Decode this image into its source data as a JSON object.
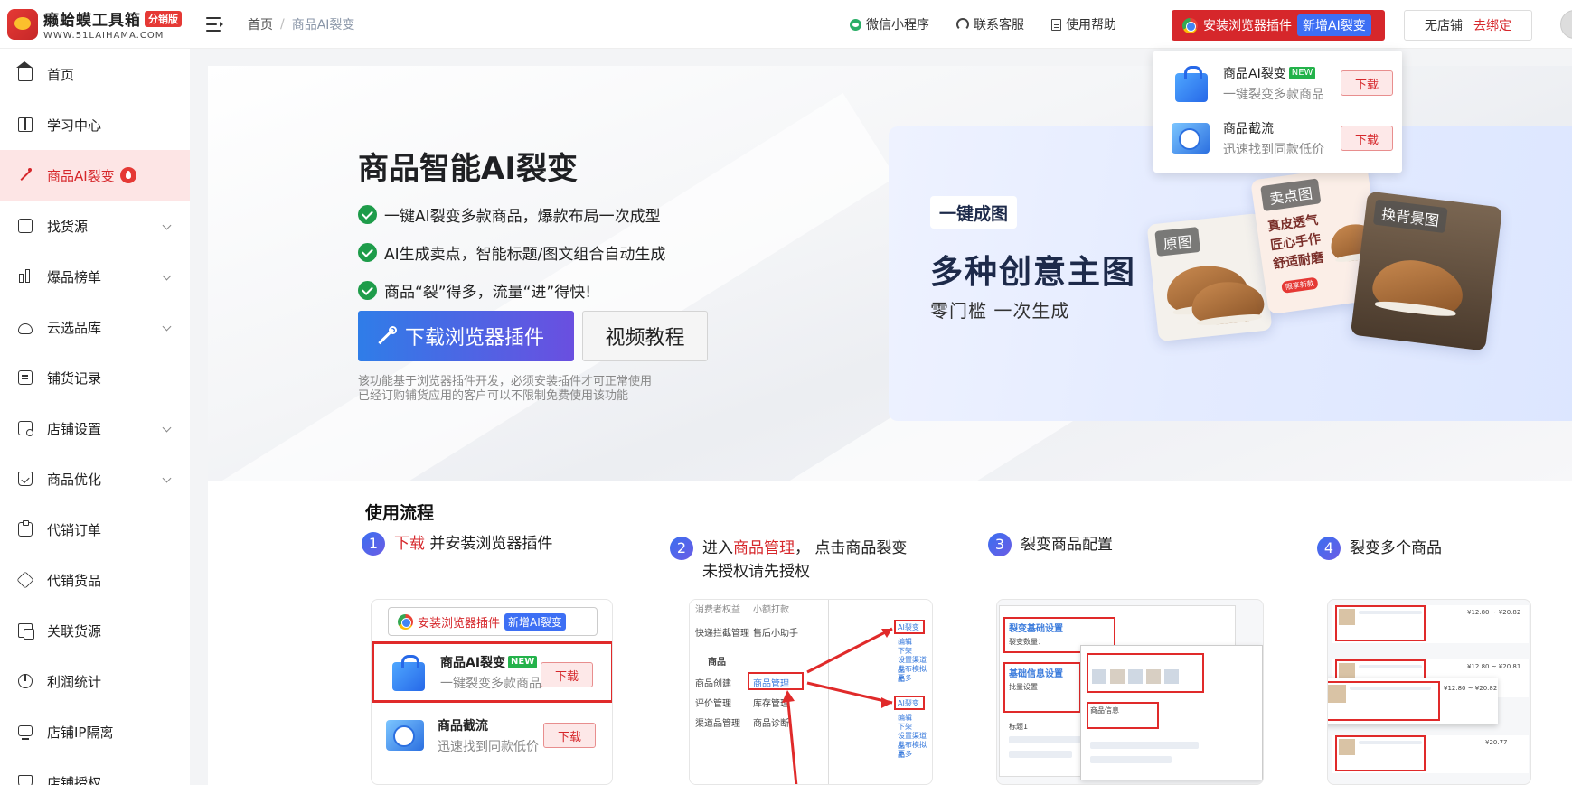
{
  "header": {
    "logo_title": "癞蛤蟆工具箱",
    "logo_badge": "分销版",
    "logo_sub": "WWW.51LAIHAMA.COM",
    "breadcrumb": [
      "首页",
      "/",
      "商品AI裂变"
    ],
    "links": [
      {
        "icon": "wechat-icon",
        "label": "微信小程序"
      },
      {
        "icon": "headset-icon",
        "label": "联系客服"
      },
      {
        "icon": "document-icon",
        "label": "使用帮助"
      }
    ],
    "install_button": {
      "label": "安装浏览器插件",
      "tag": "新增AI裂变"
    },
    "store": {
      "label": "无店铺",
      "action": "去绑定"
    }
  },
  "sidebar": {
    "items": [
      {
        "label": "首页",
        "icon": "home-icon",
        "chevron": false
      },
      {
        "label": "学习中心",
        "icon": "book-icon",
        "chevron": false
      },
      {
        "label": "商品AI裂变",
        "icon": "magic-wand-icon",
        "chevron": false,
        "active": true,
        "badge": "fire-icon"
      },
      {
        "label": "找货源",
        "icon": "inbox-icon",
        "chevron": true
      },
      {
        "label": "爆品榜单",
        "icon": "bar-chart-icon",
        "chevron": true
      },
      {
        "label": "云选品库",
        "icon": "cloud-icon",
        "chevron": true
      },
      {
        "label": "铺货记录",
        "icon": "list-icon",
        "chevron": false
      },
      {
        "label": "店铺设置",
        "icon": "shop-settings-icon",
        "chevron": true
      },
      {
        "label": "商品优化",
        "icon": "bag-check-icon",
        "chevron": true
      },
      {
        "label": "代销订单",
        "icon": "clipboard-icon",
        "chevron": false
      },
      {
        "label": "代销货品",
        "icon": "box-icon",
        "chevron": false
      },
      {
        "label": "关联货源",
        "icon": "link-icon",
        "chevron": false
      },
      {
        "label": "利润统计",
        "icon": "pie-chart-icon",
        "chevron": false
      },
      {
        "label": "店铺IP隔离",
        "icon": "monitor-icon",
        "chevron": false
      },
      {
        "label": "店铺授权",
        "icon": "shield-icon",
        "chevron": false
      }
    ]
  },
  "popover": {
    "items": [
      {
        "title": "商品AI裂变",
        "tag": "NEW",
        "desc": "一键裂变多款商品",
        "button": "下载"
      },
      {
        "title": "商品截流",
        "tag": "",
        "desc": "迅速找到同款低价",
        "button": "下载"
      }
    ]
  },
  "hero": {
    "title": "商品智能AI裂变",
    "features": [
      "一键AI裂变多款商品，爆款布局一次成型",
      "AI生成卖点，智能标题/图文组合自动生成",
      "商品“裂”得多，流量“进”得快!"
    ],
    "download_button": "下载浏览器插件",
    "video_button": "视频教程",
    "notice_lines": [
      "该功能基于浏览器插件开发，必须安装插件才可正常使用",
      "已经订购铺货应用的客户可以不限制免费使用该功能"
    ]
  },
  "banner": {
    "tag": "一键成图",
    "title": "多种创意主图",
    "subtitle": "零门槛 一次生成",
    "cards": [
      {
        "label": "原图"
      },
      {
        "label": "卖点图",
        "text": [
          "真皮透气",
          "匠心手作",
          "舒适耐磨"
        ],
        "pill": "限享新款"
      },
      {
        "label": "换背景图"
      }
    ]
  },
  "process": {
    "title": "使用流程",
    "steps": [
      {
        "num": "1",
        "pre": "",
        "highlight": "下载",
        "post": " 并安装浏览器插件",
        "line2": ""
      },
      {
        "num": "2",
        "pre": "进入",
        "highlight": "商品管理",
        "post": "， 点击商品裂变",
        "line2": "未授权请先授权"
      },
      {
        "num": "3",
        "pre": "",
        "highlight": "",
        "post": "裂变商品配置",
        "line2": ""
      },
      {
        "num": "4",
        "pre": "",
        "highlight": "",
        "post": "裂变多个商品",
        "line2": ""
      }
    ],
    "thumb1": {
      "install_label": "安装浏览器插件",
      "install_tag": "新增AI裂变",
      "rows": [
        {
          "title": "商品AI裂变",
          "tag": "NEW",
          "desc": "一键裂变多款商品",
          "button": "下载"
        },
        {
          "title": "商品截流",
          "tag": "",
          "desc": "迅速找到同款低价",
          "button": "下载"
        }
      ]
    },
    "thumb2": {
      "menu": [
        "消费者权益",
        "小额打款",
        "快递拦截管理",
        "售后小助手",
        "商品",
        "商品创建",
        "商品管理",
        "评价管理",
        "库存管理",
        "渠道品管理",
        "商品诊断"
      ],
      "links": [
        "AI裂变",
        "编辑",
        "下架",
        "设置渠道品",
        "发布模拟品",
        "更多",
        "AI裂变",
        "编辑",
        "下架",
        "设置渠道品",
        "发布模拟品",
        "更多"
      ]
    },
    "thumb3": {
      "labels": [
        "裂变基础设置",
        "裂变数量：",
        "基础信息设置",
        "批量设置",
        "标题1",
        "商品信息"
      ]
    },
    "thumb4": {
      "price_labels": [
        "¥12.80 ~ ¥20.82",
        "¥12.80 ~ ¥20.81",
        "¥12.80 ~ ¥20.82",
        "¥20.77"
      ]
    }
  }
}
